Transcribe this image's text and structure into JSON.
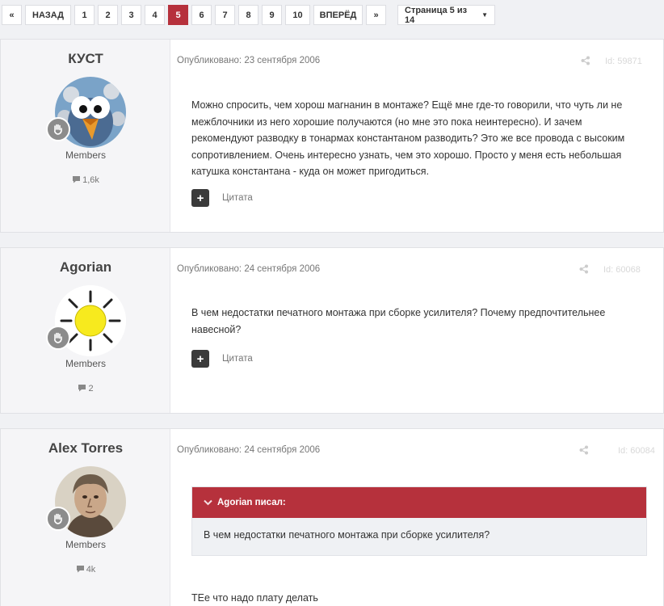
{
  "pagination": {
    "first_label": "«",
    "prev_label": "НАЗАД",
    "pages": [
      "1",
      "2",
      "3",
      "4",
      "5",
      "6",
      "7",
      "8",
      "9",
      "10"
    ],
    "current_page": "5",
    "next_label": "ВПЕРЁД",
    "last_label": "»",
    "jump_label": "Страница 5 из 14",
    "accent_color": "#b6313c"
  },
  "posts": [
    {
      "author": "КУСТ",
      "group": "Members",
      "post_count": "1,6k",
      "date_line": "Опубликовано: 23 сентября 2006",
      "post_id": "Id: 59871",
      "paragraphs": [
        "Можно спросить, чем хорош магнанин в монтаже? Ещё мне где-то говорили, что чуть ли не межблочники из него хорошие получаются (но мне это пока неинтересно). И зачем рекомендуют разводку в тонармах константаном разводить? Это же все провода с высоким сопротивлением. Очень интересно узнать, чем это хорошо. Просто у меня есть небольшая катушка константана - куда он может пригодиться."
      ],
      "quote_button_label": "Цитата",
      "avatar_icon": "bird-cartoon-avatar"
    },
    {
      "author": "Agorian",
      "group": "Members",
      "post_count": "2",
      "date_line": "Опубликовано: 24 сентября 2006",
      "post_id": "Id: 60068",
      "paragraphs": [
        "В чем недостатки печатного монтажа при сборке усилителя? Почему предпочтительнее навесной?"
      ],
      "quote_button_label": "Цитата",
      "avatar_icon": "sun-avatar"
    },
    {
      "author": "Alex Torres",
      "group": "Members",
      "post_count": "4k",
      "date_line": "Опубликовано: 24 сентября 2006",
      "post_id": "Id: 60084",
      "quote": {
        "header": "Agorian писал:",
        "text": "В чем недостатки печатного монтажа при сборке усилителя?"
      },
      "paragraphs": [
        "ТЕе что надо плату делать"
      ],
      "avatar_icon": "portrait-avatar"
    }
  ]
}
